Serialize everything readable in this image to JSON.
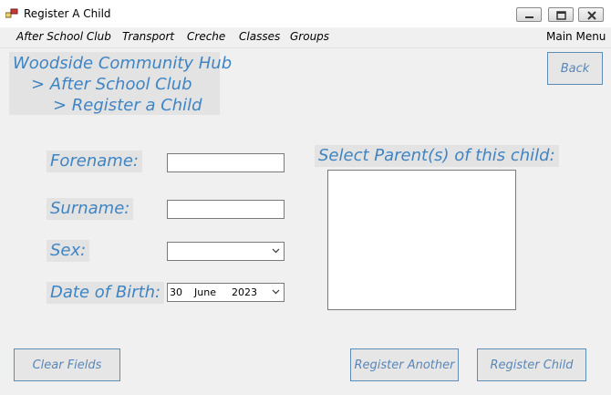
{
  "window": {
    "title": "Register A Child",
    "icon": "app-icon"
  },
  "menu": {
    "items": [
      "After School Club",
      "Transport",
      "Creche",
      "Classes",
      "Groups"
    ],
    "main_menu": "Main Menu"
  },
  "breadcrumb": {
    "level1": "Woodside Community Hub",
    "level2": "> After School Club",
    "level3": "> Register a Child"
  },
  "buttons": {
    "back": "Back",
    "clear": "Clear Fields",
    "register_another": "Register Another",
    "register_child": "Register Child"
  },
  "form": {
    "forename_label": "Forename:",
    "forename_value": "",
    "surname_label": "Surname:",
    "surname_value": "",
    "sex_label": "Sex:",
    "sex_value": "",
    "dob_label": "Date of Birth:",
    "dob": {
      "day": "30",
      "month": "June",
      "year": "2023"
    },
    "parents_label": "Select Parent(s) of this child:"
  },
  "colors": {
    "accent_text": "#3f84c3",
    "label_bg": "#e3e3e3",
    "button_border": "#5c8db8"
  }
}
